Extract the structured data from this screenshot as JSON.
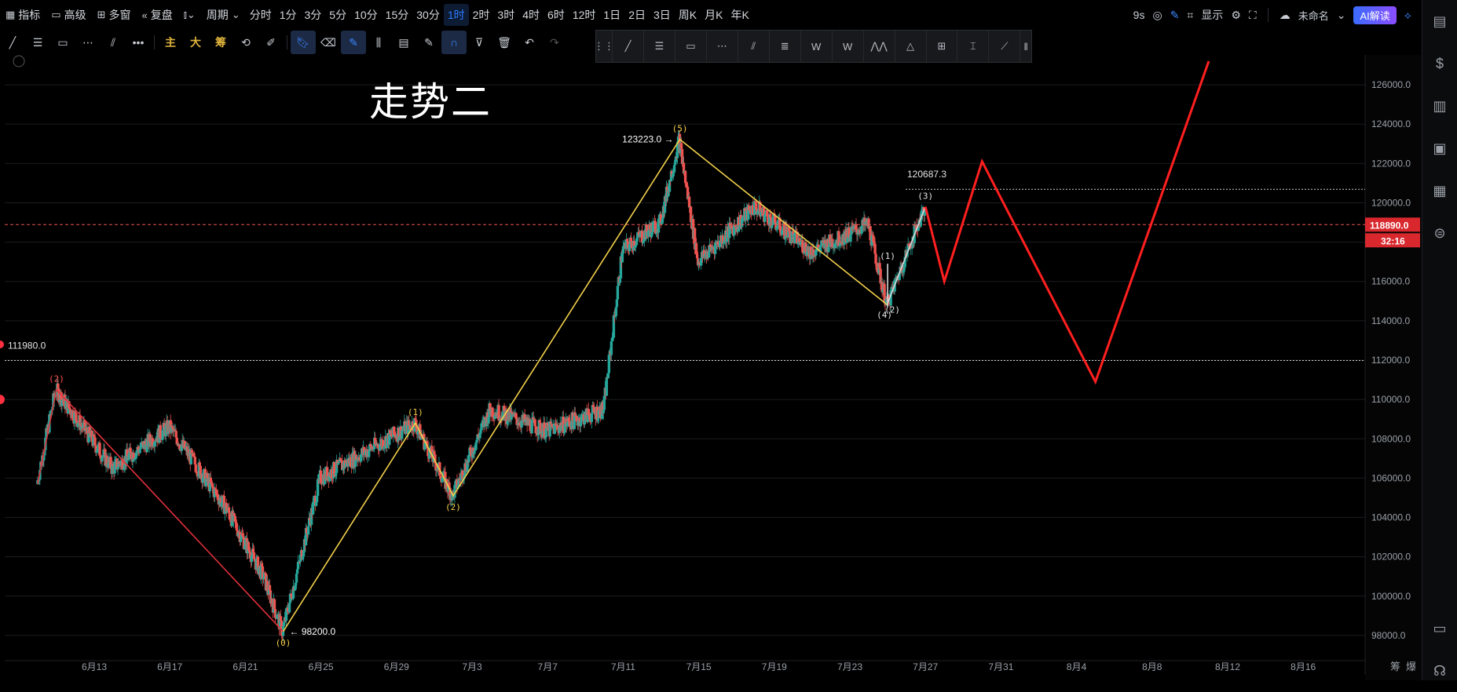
{
  "topbar": {
    "items": [
      {
        "label": "指标",
        "icon": "indicator-icon"
      },
      {
        "label": "高级",
        "icon": "advanced-icon"
      },
      {
        "label": "多窗",
        "icon": "multi-window-icon"
      },
      {
        "label": "复盘",
        "icon": "replay-icon"
      },
      {
        "label": "",
        "icon": "chart-type-icon"
      },
      {
        "label": "周期",
        "icon": "chevron-down-icon"
      }
    ],
    "intervals": [
      "分时",
      "1分",
      "3分",
      "5分",
      "10分",
      "15分",
      "30分",
      "1时",
      "2时",
      "3时",
      "4时",
      "6时",
      "12时",
      "1日",
      "2日",
      "3日",
      "周K",
      "月K",
      "年K"
    ],
    "active_interval": "1时",
    "right": {
      "countdown": "9s",
      "display": "显示",
      "unnamed": "未命名",
      "ai": "AI解读"
    }
  },
  "toolbar2": {
    "labels": [
      "主",
      "大",
      "筹"
    ]
  },
  "overlay_text": "走势二",
  "colors": {
    "bull": "#26a69a",
    "bear": "#ef5350",
    "yellow": "#f2d04a",
    "red": "#ff1f1f",
    "grid": "#1a1c20",
    "price_line": "#ef5350"
  },
  "chart_data": {
    "type": "candlestick",
    "symbol_title": "走势二",
    "ylim": [
      96800,
      127200
    ],
    "y_ticks": [
      98000,
      100000,
      102000,
      104000,
      106000,
      108000,
      110000,
      112000,
      114000,
      116000,
      118000,
      120000,
      122000,
      124000,
      126000
    ],
    "y_tick_labels": [
      "98000.0",
      "100000.0",
      "102000.0",
      "104000.0",
      "106000.0",
      "108000.0",
      "110000.0",
      "112000.0",
      "114000.0",
      "116000.0",
      "118000.0",
      "120000.0",
      "122000.0",
      "124000.0",
      "126000.0"
    ],
    "x_tick_labels": [
      "6月13",
      "6月17",
      "6月21",
      "6月25",
      "6月29",
      "7月3",
      "7月7",
      "7月11",
      "7月15",
      "7月19",
      "7月23",
      "7月27",
      "7月31",
      "8月4",
      "8月8",
      "8月12",
      "8月16"
    ],
    "current_price": "118890.0",
    "countdown": "32:16",
    "horizontal_lines": [
      {
        "label": "111980.0",
        "value": 111980
      },
      {
        "label": "120687.3",
        "value": 120687.3
      }
    ],
    "annotations": [
      {
        "text": "123223.0",
        "value": 123223.0
      },
      {
        "text": "98200.0",
        "value": 98200.0
      }
    ],
    "waves": {
      "yellow": {
        "points": [
          [
            "6月23",
            98200
          ],
          [
            "6月30",
            108800
          ],
          [
            "7月2",
            105100
          ],
          [
            "7月14",
            123223
          ],
          [
            "7月25",
            114800
          ]
        ],
        "labels": [
          "(0)",
          "(1)",
          "(2)",
          "(5)",
          "(4)"
        ]
      },
      "red_prior": {
        "points": [
          [
            "6月10",
            105700
          ],
          [
            "6月11",
            110500
          ],
          [
            "6月23",
            98200
          ]
        ],
        "labels": [
          "(2)"
        ]
      },
      "white": {
        "points": [
          [
            "7月25",
            114700
          ],
          [
            "7月25",
            116900
          ],
          [
            "7月25",
            114900
          ],
          [
            "7月27",
            119800
          ]
        ],
        "labels": [
          "(1)",
          "(2)",
          "(3)"
        ]
      },
      "red_projection": {
        "points": [
          [
            "7月27",
            119800
          ],
          [
            "7月28",
            116000
          ],
          [
            "7月30",
            122100
          ],
          [
            "8月5",
            110900
          ],
          [
            "8月11",
            127200
          ]
        ]
      }
    },
    "bottom_right": [
      "筹",
      "爆"
    ]
  }
}
